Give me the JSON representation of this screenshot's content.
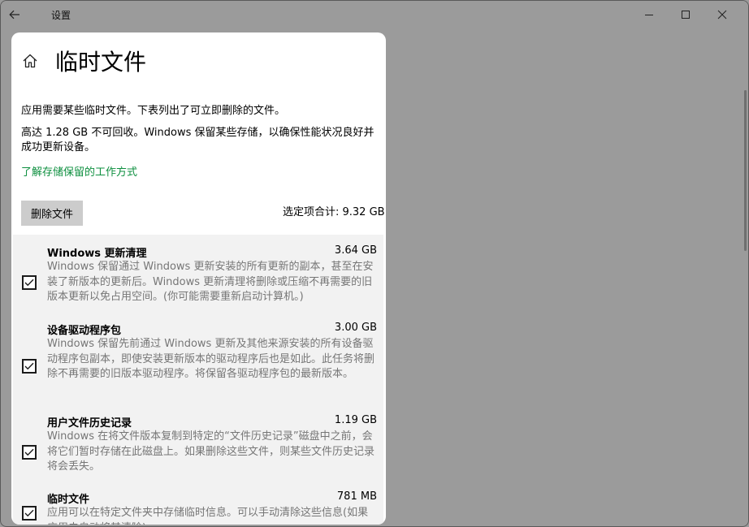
{
  "window": {
    "app_title": "设置"
  },
  "page": {
    "title": "临时文件",
    "description1": "应用需要某些临时文件。下表列出了可立即删除的文件。",
    "description2": "高达 1.28 GB 不可回收。Windows 保留某些存储，以确保性能状况良好并成功更新设备。",
    "learn_link": "了解存储保留的工作方式",
    "delete_button": "删除文件",
    "total_selected": "选定项合计: 9.32 GB"
  },
  "items": [
    {
      "name": "Windows 更新清理",
      "size": "3.64 GB",
      "checked": true,
      "description": "Windows 保留通过 Windows 更新安装的所有更新的副本，甚至在安装了新版本的更新后。Windows 更新清理将删除或压缩不再需要的旧版本更新以免占用空间。(你可能需要重新启动计算机。)"
    },
    {
      "name": "设备驱动程序包",
      "size": "3.00 GB",
      "checked": true,
      "description": "Windows 保留先前通过 Windows 更新及其他来源安装的所有设备驱动程序包副本，即使安装更新版本的驱动程序后也是如此。此任务将删除不再需要的旧版本驱动程序。将保留各驱动程序包的最新版本。"
    },
    {
      "name": "用户文件历史记录",
      "size": "1.19 GB",
      "checked": true,
      "description": "Windows 在将文件版本复制到特定的“文件历史记录”磁盘中之前，会将它们暂时存储在此磁盘上。如果删除这些文件，则某些文件历史记录将会丢失。"
    },
    {
      "name": "临时文件",
      "size": "781 MB",
      "checked": true,
      "description": "应用可以在特定文件夹中存储临时信息。可以手动清除这些信息(如果应用未自动将其清除)。"
    }
  ],
  "icons": {
    "back": "back-arrow-icon",
    "home": "home-icon",
    "minimize": "minimize-icon",
    "maximize": "maximize-icon",
    "close": "close-icon",
    "checkmark": "checkmark-icon"
  },
  "colors": {
    "link": "#0d8f3f",
    "background": "#9b9b9b",
    "panel": "#ffffff",
    "list_background": "#f2f2f2",
    "description_text": "#767676"
  }
}
